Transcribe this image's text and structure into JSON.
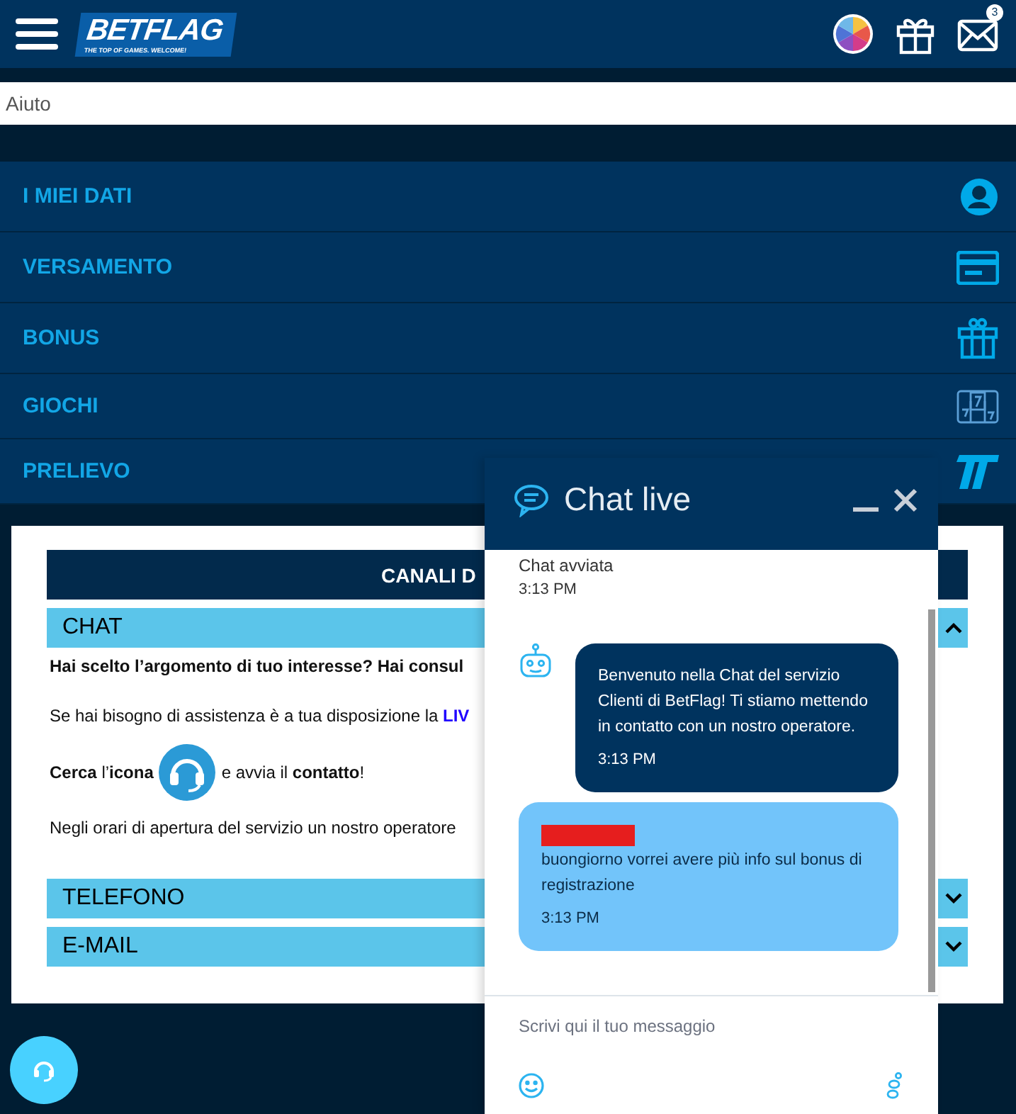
{
  "header": {
    "logo": "BETFLAG",
    "tagline": "THE TOP OF GAMES. WELCOME!",
    "mail_badge": "3"
  },
  "page_title": "Aiuto",
  "menu": [
    {
      "label": "I MIEI DATI",
      "kind": "user"
    },
    {
      "label": "VERSAMENTO",
      "kind": "card"
    },
    {
      "label": "BONUS",
      "kind": "gift"
    },
    {
      "label": "GIOCHI",
      "kind": "slots"
    },
    {
      "label": "PRELIEVO",
      "kind": "logo"
    }
  ],
  "panel": {
    "title": "CANALI D",
    "sections": [
      {
        "label": "CHAT",
        "expanded": true,
        "paragraphs": [
          {
            "kind": "text",
            "text": "**Hai scelto l’argomento di tuo interesse? Hai consul**"
          },
          {
            "kind": "link",
            "text": "Se hai bisogno di assistenza è a tua disposizione la ",
            "link": "LIV"
          },
          {
            "kind": "icon",
            "before": "**Cerca** l’**icona**",
            "after": "e avvia il **contatto**!"
          },
          {
            "kind": "text",
            "text": "Negli orari di apertura del servizio un nostro operatore"
          }
        ]
      },
      {
        "label": "TELEFONO",
        "expanded": false
      },
      {
        "label": "E-MAIL",
        "expanded": false
      }
    ]
  },
  "chat": {
    "title": "Chat live",
    "status": "Chat avviata",
    "status_time": "3:13 PM",
    "messages": [
      {
        "kind": "bot",
        "text": "Benvenuto nella Chat del servizio Clienti di BetFlag! Ti stiamo mettendo in contatto con un nostro operatore.",
        "time": "3:13 PM"
      },
      {
        "kind": "user",
        "text": "buongiorno vorrei avere più info sul bonus di registrazione",
        "time": "3:13 PM"
      }
    ],
    "input_placeholder": "Scrivi qui il tuo messaggio"
  }
}
